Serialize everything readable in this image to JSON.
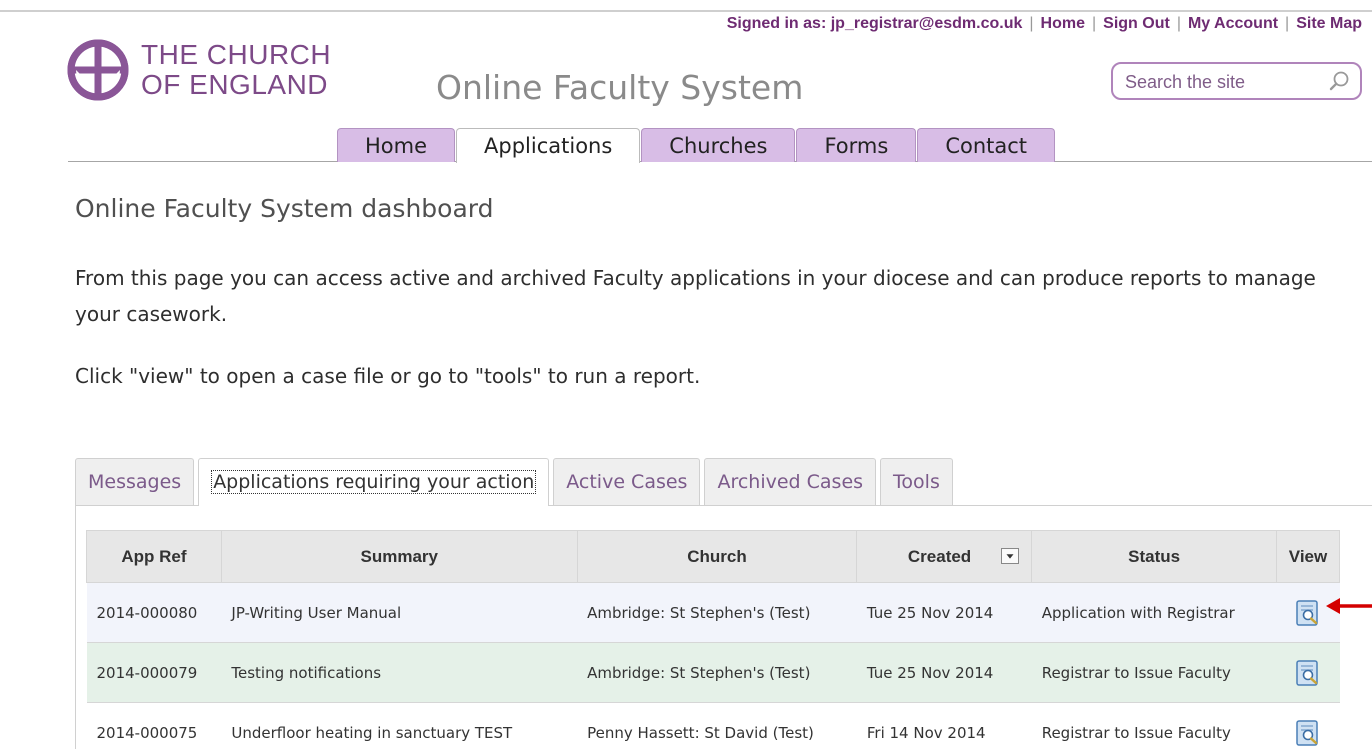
{
  "header": {
    "signed_in_label": "Signed in as: jp_registrar@esdm.co.uk",
    "links": [
      "Home",
      "Sign Out",
      "My Account",
      "Site Map"
    ],
    "logo_line1": "THE CHURCH",
    "logo_line2": "OF ENGLAND",
    "site_title": "Online Faculty System",
    "search_placeholder": "Search the site"
  },
  "nav": {
    "tabs": [
      "Home",
      "Applications",
      "Churches",
      "Forms",
      "Contact"
    ],
    "active": "Applications"
  },
  "main": {
    "title": "Online Faculty System dashboard",
    "intro": "From this page you can access active and archived Faculty applications in your diocese and can produce reports to manage your casework.",
    "instructions": "Click \"view\" to open a case file or go to \"tools\" to run a report."
  },
  "dashboard_tabs": {
    "tabs": [
      "Messages",
      "Applications requiring your action",
      "Active Cases",
      "Archived Cases",
      "Tools"
    ],
    "active": "Applications requiring your action"
  },
  "table": {
    "columns": [
      "App Ref",
      "Summary",
      "Church",
      "Created",
      "Status",
      "View"
    ],
    "rows": [
      {
        "ref": "2014-000080",
        "summary": "JP-Writing User Manual",
        "church": "Ambridge: St Stephen's (Test)",
        "created": "Tue 25 Nov 2014",
        "status": "Application with Registrar"
      },
      {
        "ref": "2014-000079",
        "summary": "Testing notifications",
        "church": "Ambridge: St Stephen's (Test)",
        "created": "Tue 25 Nov 2014",
        "status": "Registrar to Issue Faculty"
      },
      {
        "ref": "2014-000075",
        "summary": "Underfloor heating in sanctuary TEST",
        "church": "Penny Hassett: St David (Test)",
        "created": "Fri 14 Nov 2014",
        "status": "Registrar to Issue Faculty"
      }
    ]
  },
  "colors": {
    "brand_purple": "#7d4a88",
    "nav_tab": "#d8bde6",
    "row_alt": "#e5f1e8",
    "arrow": "#d40000"
  },
  "icons": [
    "search-icon",
    "view-icon",
    "sort-dropdown-icon",
    "arrow-annotation"
  ]
}
